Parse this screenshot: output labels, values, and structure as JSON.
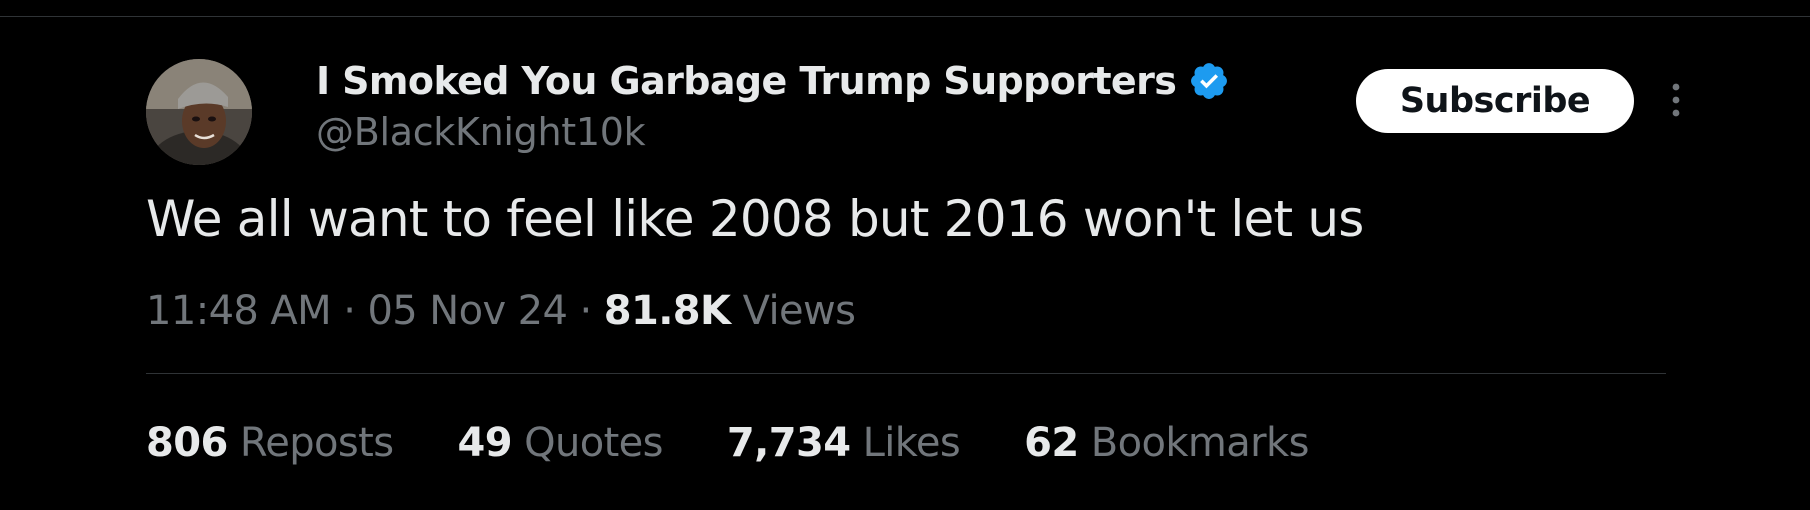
{
  "post": {
    "author": {
      "display_name": "I Smoked You Garbage Trump Supporters",
      "handle": "@BlackKnight10k",
      "verified": true,
      "verified_color": "#1d9bf0",
      "avatar_icon": "profile-photo"
    },
    "subscribe_label": "Subscribe",
    "more_icon": "more-vertical-icon",
    "text": "We all want to feel like 2008 but 2016 won't let us",
    "time": "11:48 AM",
    "separator": "·",
    "date": "05 Nov 24",
    "views_count": "81.8K",
    "views_label": "Views",
    "stats": [
      {
        "count": "806",
        "label": "Reposts"
      },
      {
        "count": "49",
        "label": "Quotes"
      },
      {
        "count": "7,734",
        "label": "Likes"
      },
      {
        "count": "62",
        "label": "Bookmarks"
      }
    ]
  },
  "colors": {
    "background": "#000000",
    "text_primary": "#e7e9ea",
    "text_secondary": "#71767b",
    "divider": "#2f3336",
    "button_bg": "#ffffff",
    "button_text": "#0f1419"
  }
}
